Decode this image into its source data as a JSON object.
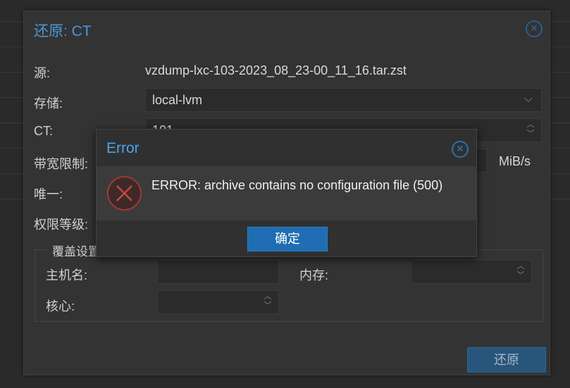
{
  "restore_window": {
    "title": "还原: CT",
    "fields": {
      "source_label": "源:",
      "source_value": "vzdump-lxc-103-2023_08_23-00_11_16.tar.zst",
      "storage_label": "存储:",
      "storage_value": "local-lvm",
      "ct_label": "CT:",
      "ct_value": "101",
      "bandwidth_label": "带宽限制:",
      "bandwidth_unit": "MiB/s",
      "unique_label": "唯一:",
      "privilege_label": "权限等级:"
    },
    "override": {
      "legend": "覆盖设置",
      "hostname_label": "主机名:",
      "memory_label": "内存:",
      "cores_label": "核心:"
    },
    "restore_button": "还原"
  },
  "error_dialog": {
    "title": "Error",
    "message": "ERROR: archive contains no configuration file (500)",
    "ok_button": "确定"
  },
  "icons": {
    "close": "close-circle-icon",
    "error": "error-x-icon",
    "chevron": "chevron-down-icon",
    "spinner": "spinner-arrows-icon"
  },
  "colors": {
    "accent": "#4a97d8",
    "primary_button": "#1f6db2",
    "error_red": "#a23a32"
  }
}
